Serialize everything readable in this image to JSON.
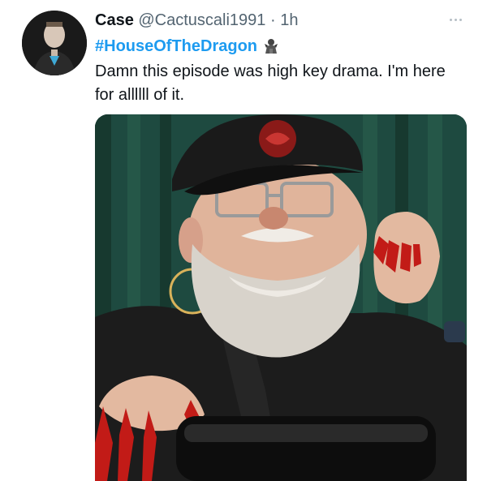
{
  "tweet": {
    "author_name": "Case",
    "author_handle": "@Cactuscali1991",
    "separator": "·",
    "time": "1h",
    "hashtag": "#HouseOfTheDragon",
    "hashtag_emoji_icon": "dragon-emoji-icon",
    "text": "Damn this episode was high key drama. I'm here for allllll of it."
  },
  "icons": {
    "more": "more-options-icon",
    "avatar": "user-avatar"
  },
  "colors": {
    "hashtag": "#1d9bf0",
    "muted": "#536471",
    "curtain": "#1e4a40"
  }
}
